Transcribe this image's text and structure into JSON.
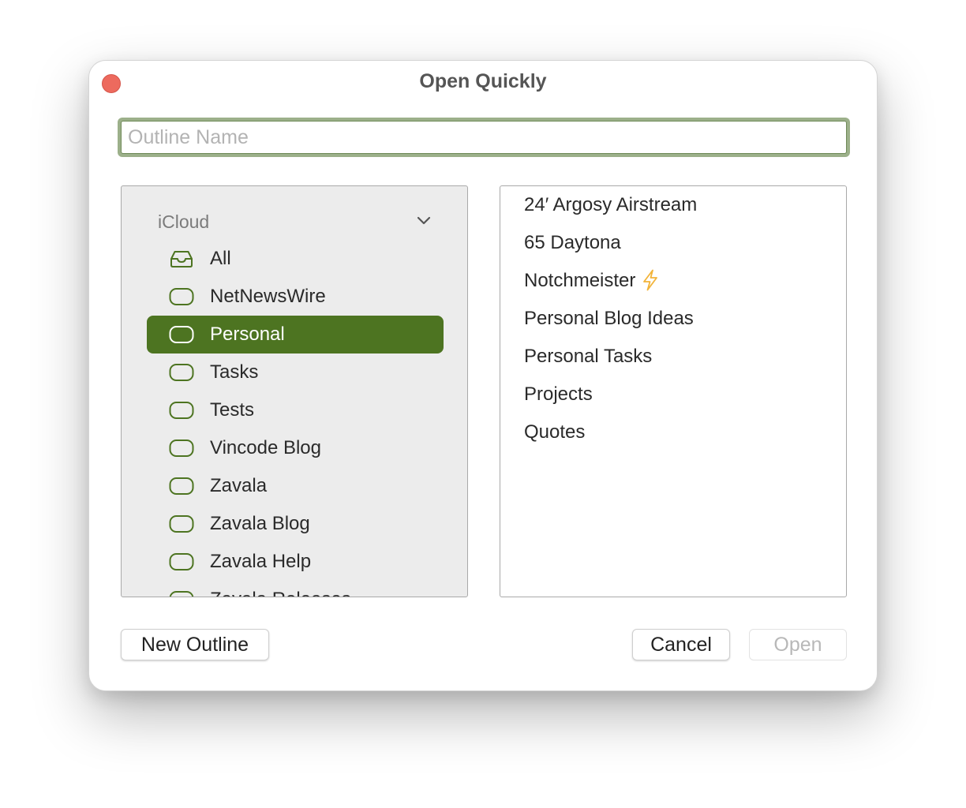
{
  "window": {
    "title": "Open Quickly"
  },
  "search": {
    "placeholder": "Outline Name",
    "value": ""
  },
  "sidebar": {
    "section": "iCloud",
    "items": [
      {
        "label": "All",
        "icon": "inbox-icon",
        "selected": false
      },
      {
        "label": "NetNewsWire",
        "icon": "tag-icon",
        "selected": false
      },
      {
        "label": "Personal",
        "icon": "tag-icon",
        "selected": true
      },
      {
        "label": "Tasks",
        "icon": "tag-icon",
        "selected": false
      },
      {
        "label": "Tests",
        "icon": "tag-icon",
        "selected": false
      },
      {
        "label": "Vincode Blog",
        "icon": "tag-icon",
        "selected": false
      },
      {
        "label": "Zavala",
        "icon": "tag-icon",
        "selected": false
      },
      {
        "label": "Zavala Blog",
        "icon": "tag-icon",
        "selected": false
      },
      {
        "label": "Zavala Help",
        "icon": "tag-icon",
        "selected": false
      },
      {
        "label": "Zavala Releases",
        "icon": "tag-icon",
        "selected": false
      }
    ]
  },
  "outlines": [
    {
      "title": "24′ Argosy Airstream"
    },
    {
      "title": "65 Daytona"
    },
    {
      "title": "Notchmeister",
      "icon": "lightning-bolt-icon"
    },
    {
      "title": "Personal Blog Ideas"
    },
    {
      "title": "Personal Tasks"
    },
    {
      "title": "Projects"
    },
    {
      "title": "Quotes"
    }
  ],
  "buttons": {
    "new_outline": "New Outline",
    "cancel": "Cancel",
    "open": "Open"
  },
  "colors": {
    "accent": "#4d7421",
    "focus_ring": "#9cb08a",
    "close": "#ed6a5e",
    "bolt": "#f2b43a"
  }
}
